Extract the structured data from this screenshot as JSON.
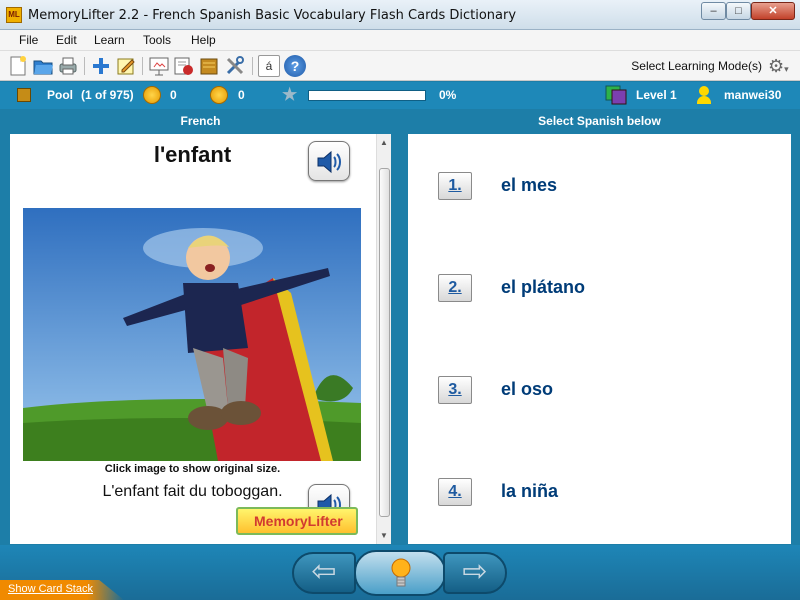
{
  "window": {
    "title": "MemoryLifter 2.2 - French Spanish Basic Vocabulary Flash Cards Dictionary",
    "app_icon_text": "ML",
    "minimize_glyph": "–",
    "maximize_glyph": "□",
    "close_glyph": "✕"
  },
  "menu": {
    "items": [
      {
        "label": "File"
      },
      {
        "label": "Edit"
      },
      {
        "label": "Learn"
      },
      {
        "label": "Tools"
      },
      {
        "label": "Help"
      }
    ]
  },
  "toolbar": {
    "icons": [
      "new-document",
      "open-folder",
      "print",
      "add-card",
      "edit-card",
      "slideshow",
      "statistics",
      "cards-archive",
      "settings-tools",
      "special-characters",
      "help"
    ],
    "accent_char": "á",
    "help_char": "?",
    "mode_label": "Select Learning Mode(s)",
    "mode_dropdown_glyph": "▾"
  },
  "status": {
    "pool_label": "Pool",
    "pool_count": "(1 of 975)",
    "correct_count": "0",
    "wrong_count": "0",
    "progress_percent": 0,
    "progress_text": "0%",
    "level": "Level 1",
    "user": "manwei30",
    "colors": {
      "bar": "#1e88b8",
      "progress_fill": "#7cc200"
    }
  },
  "question": {
    "column_label": "French",
    "word": "l'enfant",
    "image_caption": "Click image to show original size.",
    "example_sentence": "L'enfant fait du toboggan.",
    "logo_text": "MemoryLifter"
  },
  "answers": {
    "column_label": "Select Spanish below",
    "options": [
      {
        "number": "1.",
        "text": "el mes"
      },
      {
        "number": "2.",
        "text": "el plátano"
      },
      {
        "number": "3.",
        "text": "el oso"
      },
      {
        "number": "4.",
        "text": "la niña"
      }
    ]
  },
  "footer": {
    "card_stack_link": "Show Card Stack",
    "prev_glyph": "⇦",
    "next_glyph": "⇨"
  },
  "colors": {
    "accent": "#1d7ea8",
    "answer_text": "#003c78",
    "card_stack": "#f08a00"
  }
}
